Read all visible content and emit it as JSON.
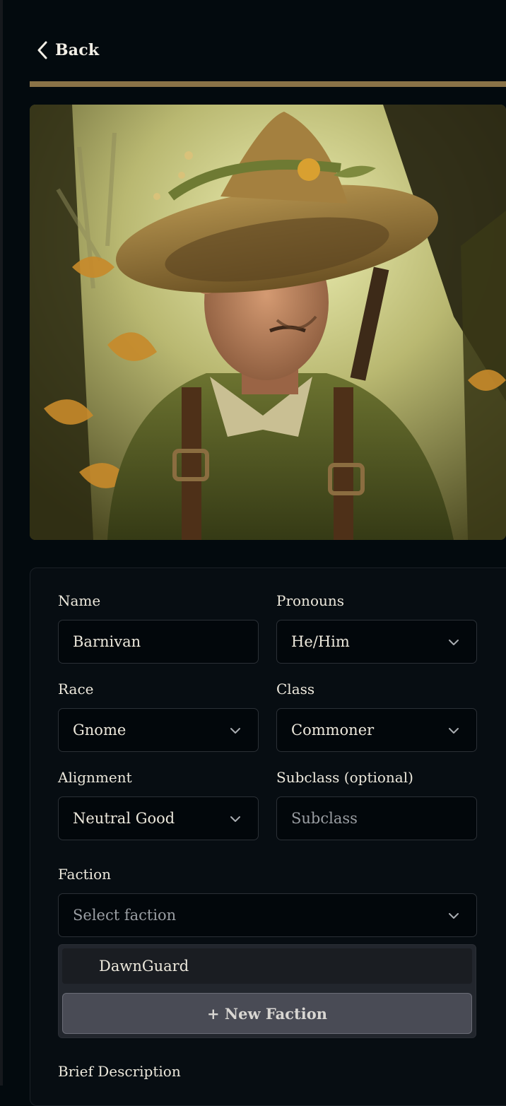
{
  "nav": {
    "back_label": "Back"
  },
  "portrait": {
    "alt": "Character portrait"
  },
  "form": {
    "name": {
      "label": "Name",
      "value": "Barnivan"
    },
    "pronouns": {
      "label": "Pronouns",
      "value": "He/Him"
    },
    "race": {
      "label": "Race",
      "value": "Gnome"
    },
    "class": {
      "label": "Class",
      "value": "Commoner"
    },
    "alignment": {
      "label": "Alignment",
      "value": "Neutral Good"
    },
    "subclass": {
      "label": "Subclass (optional)",
      "placeholder": "Subclass"
    },
    "faction": {
      "label": "Faction",
      "placeholder": "Select faction",
      "options": [
        "DawnGuard"
      ],
      "new_label": "+ New Faction"
    },
    "description": {
      "label": "Brief Description"
    }
  },
  "colors": {
    "background": "#030a0e",
    "accent_bar": "#8a7347",
    "card": "#070d12",
    "field_border": "#2b3036",
    "new_button": "#494b55"
  },
  "icons": {
    "back": "chevron-left-icon",
    "dropdown": "chevron-down-icon"
  }
}
